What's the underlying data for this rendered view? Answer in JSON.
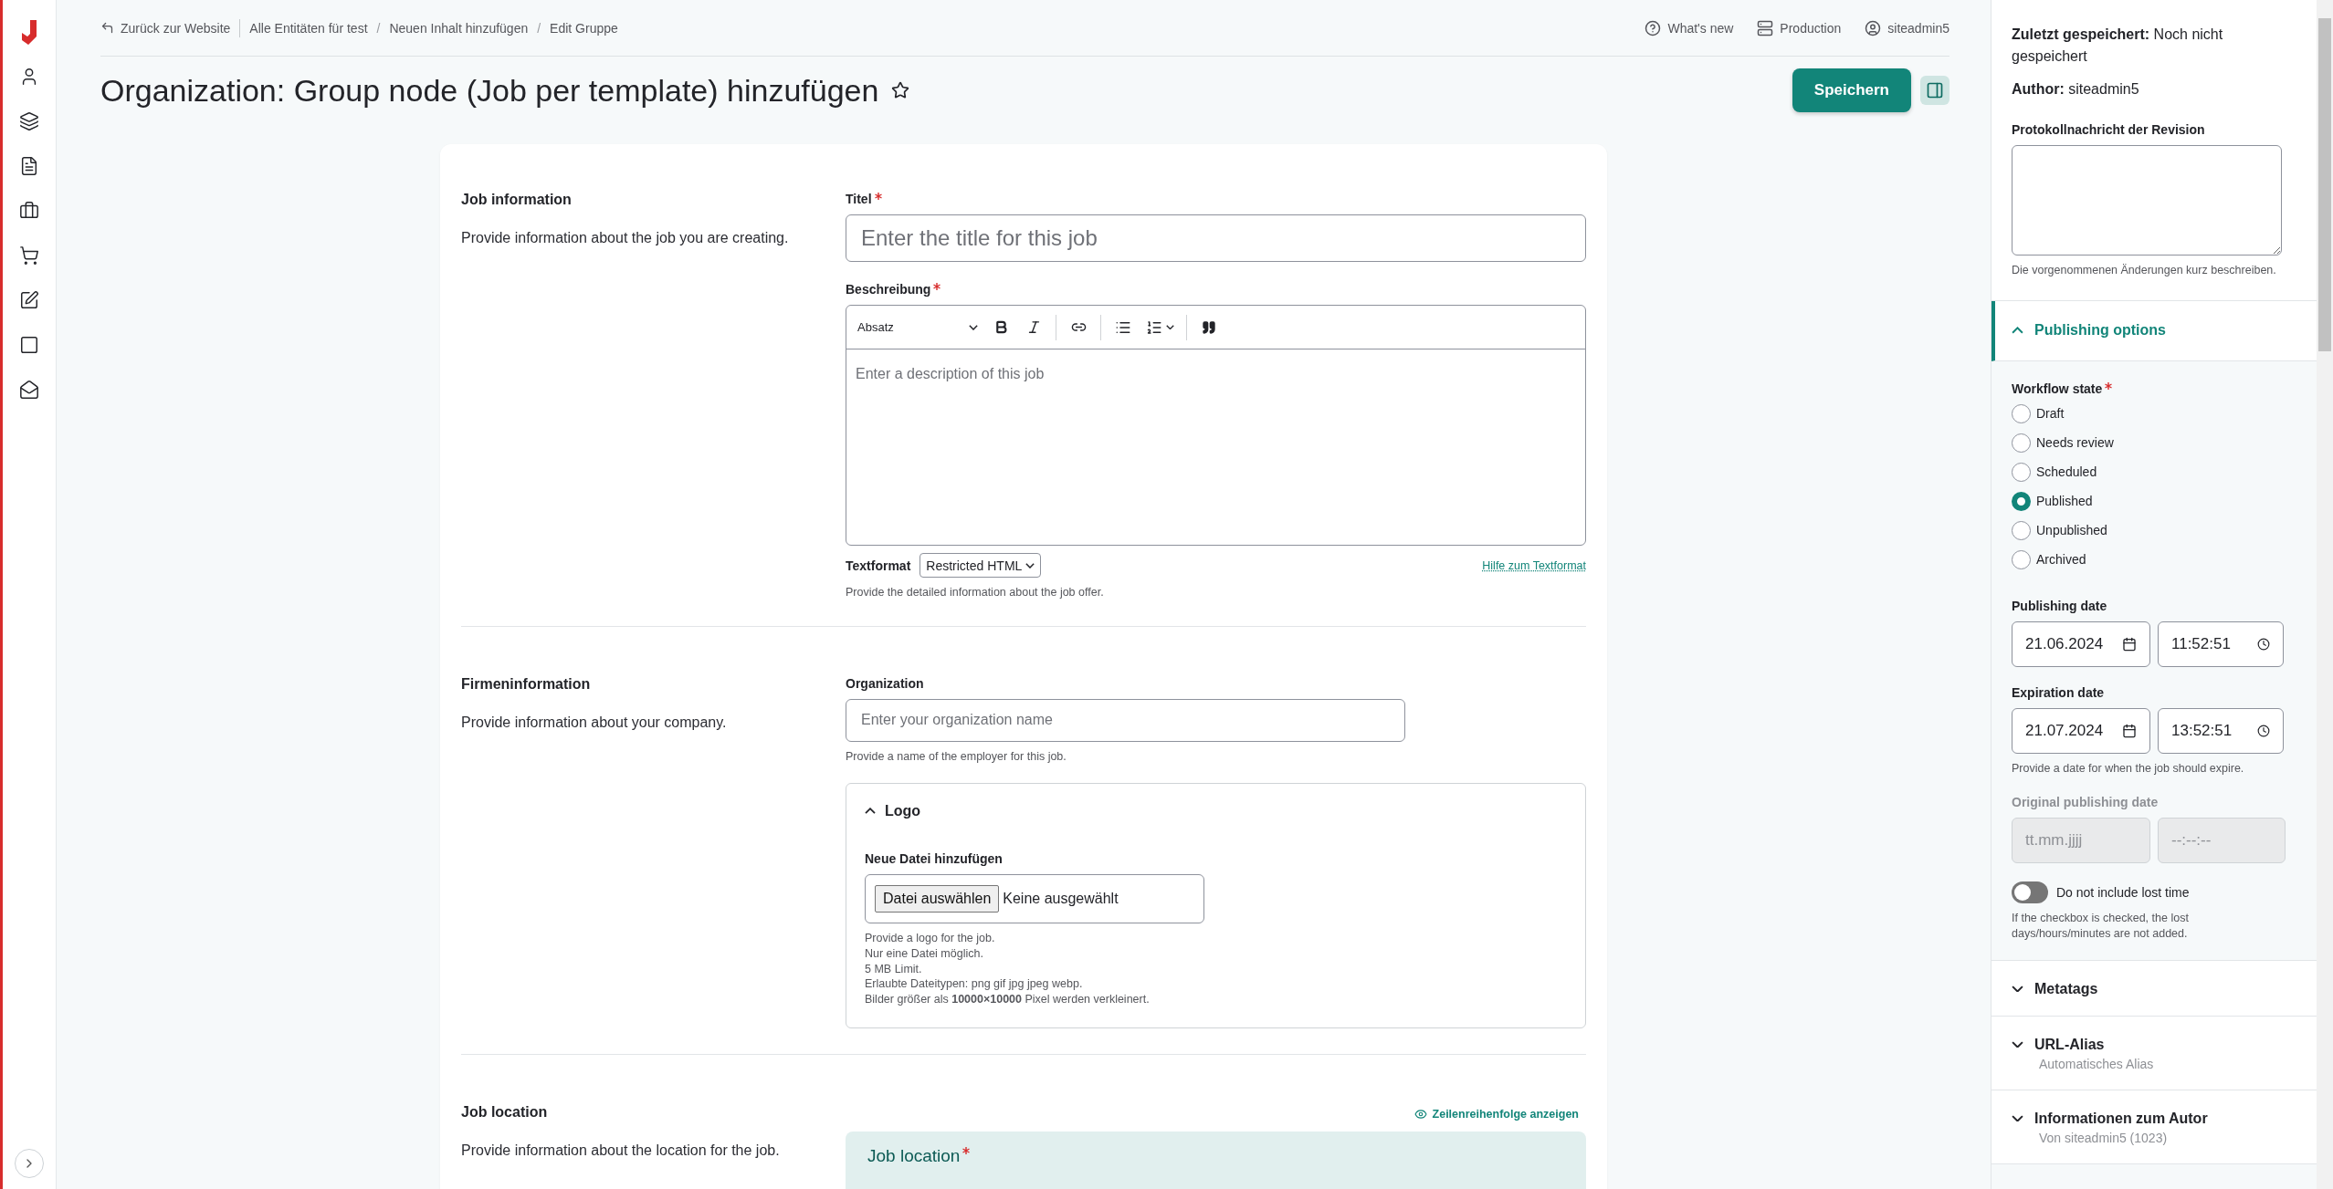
{
  "breadcrumbs": {
    "back": "Zurück zur Website",
    "items": [
      "Alle Entitäten für test",
      "Neuen Inhalt hinzufügen",
      "Edit Gruppe"
    ],
    "separator": "/"
  },
  "top_links": [
    "What's new",
    "Production",
    "siteadmin5"
  ],
  "page_title": "Organization: Group node (Job per template) hinzufügen",
  "save_button": "Speichern",
  "sections": [
    {
      "title": "Job information",
      "description": "Provide information about the job you are creating.",
      "fields": [
        {
          "kind": "title",
          "label": "Titel",
          "required": true,
          "placeholder": "Enter the title for this job"
        },
        {
          "kind": "editor",
          "label": "Beschreibung",
          "required": true,
          "format_select": "Absatz",
          "placeholder": "Enter a description of this job",
          "textformat_label": "Textformat",
          "textformat_value": "Restricted HTML",
          "help_link": "Hilfe zum Textformat",
          "help": "Provide the detailed information about the job offer."
        }
      ]
    },
    {
      "title": "Firmeninformation",
      "description": "Provide information about your company.",
      "fields": [
        {
          "kind": "text",
          "label": "Organization",
          "required": false,
          "placeholder": "Enter your organization name",
          "help": "Provide a name of the employer for this job."
        },
        {
          "kind": "file",
          "legend": "Logo",
          "expanded": true,
          "label": "Neue Datei hinzufügen",
          "button": "Datei auswählen",
          "status": "Keine ausgewählt",
          "help_lines": [
            "Provide a logo for the job.",
            "Nur eine Datei möglich.",
            "5 MB Limit.",
            "Erlaubte Dateitypen: png gif jpg jpeg webp.",
            "Bilder größer als **10000×10000** Pixel werden verkleinert."
          ]
        }
      ]
    },
    {
      "title": "Job location",
      "description": "Provide information about the location for the job.",
      "fields": [
        {
          "kind": "paragraphs",
          "link": "Zeilenreihenfolge anzeigen",
          "label": "Job location",
          "required": true
        }
      ]
    }
  ],
  "sidebar": {
    "saved_label": "Zuletzt gespeichert:",
    "saved_value": "Noch nicht gespeichert",
    "author_label": "Author:",
    "author_value": "siteadmin5",
    "revision_label": "Protokollnachricht der Revision",
    "revision_help": "Die vorgenommenen Änderungen kurz beschreiben.",
    "publishing": {
      "title": "Publishing options",
      "expanded": true,
      "workflow_label": "Workflow state",
      "workflow_required": true,
      "states": [
        {
          "label": "Draft",
          "selected": false
        },
        {
          "label": "Needs review",
          "selected": false
        },
        {
          "label": "Scheduled",
          "selected": false
        },
        {
          "label": "Published",
          "selected": true
        },
        {
          "label": "Unpublished",
          "selected": false
        },
        {
          "label": "Archived",
          "selected": false
        }
      ],
      "dates": [
        {
          "label": "Publishing date",
          "date": "21.06.2024",
          "time": "11:52:51",
          "disabled": false
        },
        {
          "label": "Expiration date",
          "date": "21.07.2024",
          "time": "13:52:51",
          "disabled": false,
          "help": "Provide a date for when the job should expire."
        },
        {
          "label": "Original publishing date",
          "date_placeholder": "tt.mm.jjjj",
          "time_placeholder": "--:--:--",
          "disabled": true
        }
      ],
      "toggle": {
        "label": "Do not include lost time",
        "on": false,
        "help": "If the checkbox is checked, the lost days/hours/minutes are not added."
      }
    },
    "accordions": [
      {
        "title": "Metatags",
        "expanded": false
      },
      {
        "title": "URL-Alias",
        "expanded": false,
        "summary": "Automatisches Alias"
      },
      {
        "title": "Informationen zum Autor",
        "expanded": false,
        "summary": "Von siteadmin5 (1023)"
      }
    ]
  }
}
